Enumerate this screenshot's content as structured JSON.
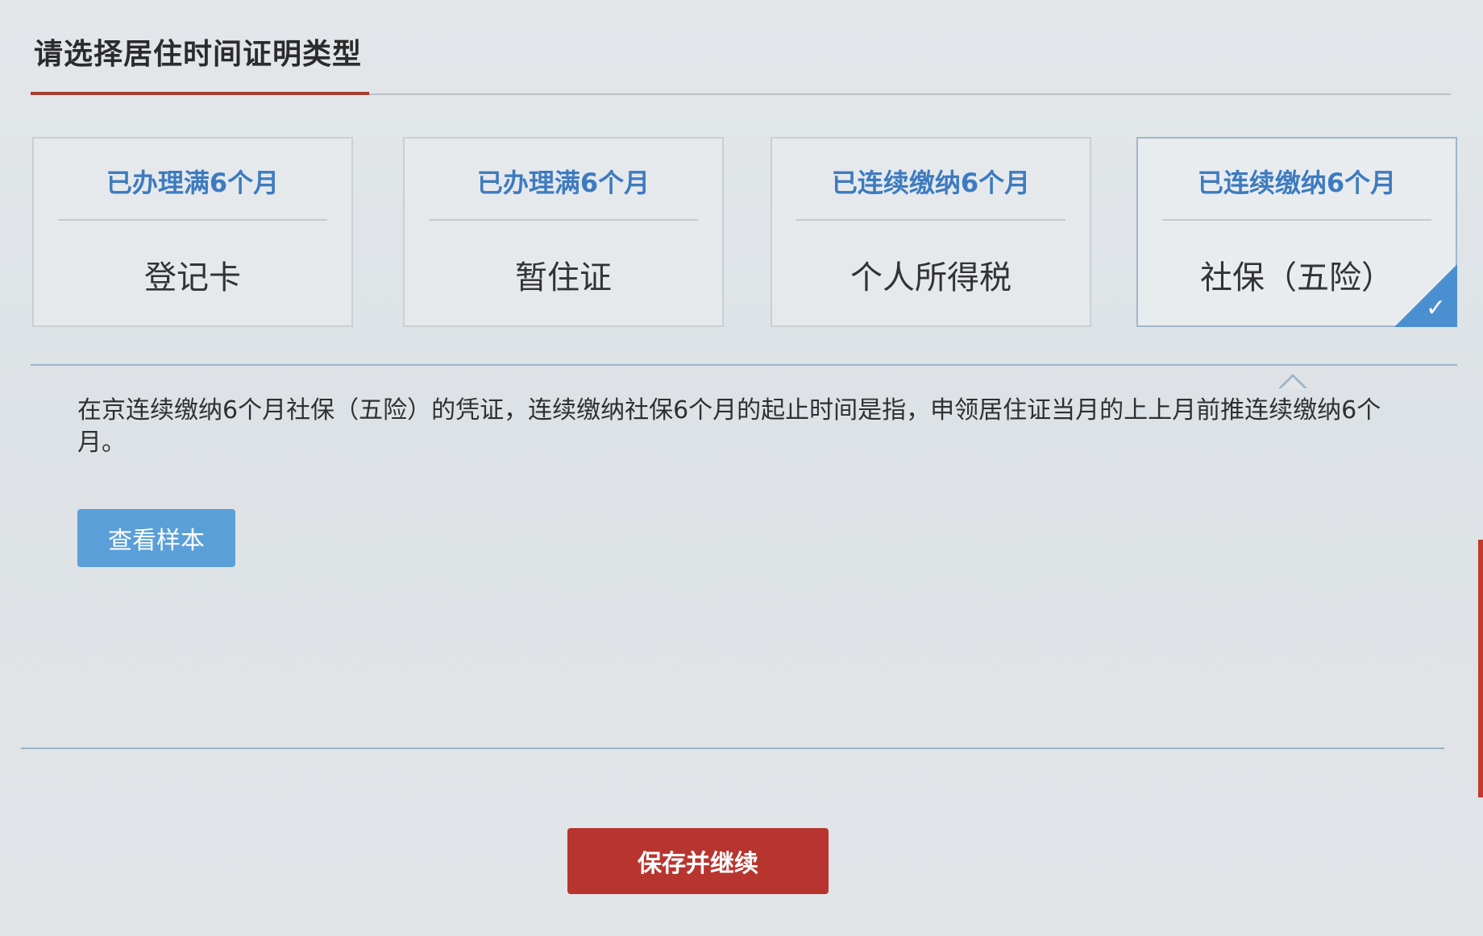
{
  "section": {
    "title": "请选择居住时间证明类型"
  },
  "cards": [
    {
      "period": "已办理满6个月",
      "name": "登记卡",
      "selected": false
    },
    {
      "period": "已办理满6个月",
      "name": "暂住证",
      "selected": false
    },
    {
      "period": "已连续缴纳6个月",
      "name": "个人所得税",
      "selected": false
    },
    {
      "period": "已连续缴纳6个月",
      "name": "社保（五险）",
      "selected": true
    }
  ],
  "detail": {
    "description": "在京连续缴纳6个月社保（五险）的凭证，连续缴纳社保6个月的起止时间是指，申领居住证当月的上上月前推连续缴纳6个月。",
    "sample_button": "查看样本"
  },
  "footer": {
    "save_button": "保存并继续"
  },
  "colors": {
    "accent_blue": "#4a8fd0",
    "primary_red": "#b8352f",
    "period_text": "#3d7bc0"
  },
  "icons": {
    "selected_check": "check-icon"
  }
}
